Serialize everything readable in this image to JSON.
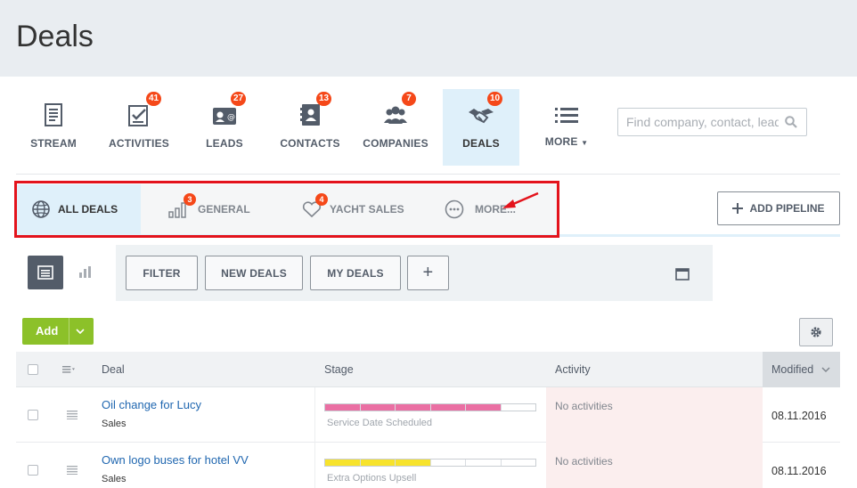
{
  "page": {
    "title": "Deals"
  },
  "nav": {
    "tabs": [
      {
        "label": "STREAM",
        "icon": "stream-icon",
        "count": null
      },
      {
        "label": "ACTIVITIES",
        "icon": "activities-icon",
        "count": "41"
      },
      {
        "label": "LEADS",
        "icon": "leads-icon",
        "count": "27"
      },
      {
        "label": "CONTACTS",
        "icon": "contacts-icon",
        "count": "13"
      },
      {
        "label": "COMPANIES",
        "icon": "companies-icon",
        "count": "7"
      },
      {
        "label": "DEALS",
        "icon": "handshake-icon",
        "count": "10",
        "active": true
      },
      {
        "label": "MORE",
        "icon": "menu-icon",
        "count": null
      }
    ],
    "search_placeholder": "Find company, contact, lead"
  },
  "pipelines": {
    "tabs": [
      {
        "label": "ALL DEALS",
        "icon": "globe-icon",
        "active": true
      },
      {
        "label": "GENERAL",
        "icon": "bar-chart-icon",
        "count": "3"
      },
      {
        "label": "YACHT SALES",
        "icon": "heart-icon",
        "count": "4"
      },
      {
        "label": "MORE...",
        "icon": "more-dots-icon"
      }
    ],
    "add_label": "ADD PIPELINE"
  },
  "filters": {
    "buttons": [
      {
        "label": "FILTER"
      },
      {
        "label": "NEW DEALS"
      },
      {
        "label": "MY DEALS"
      },
      {
        "label": "+"
      }
    ]
  },
  "toolbar": {
    "add_label": "Add"
  },
  "table": {
    "columns": {
      "deal": "Deal",
      "stage": "Stage",
      "activity": "Activity",
      "modified": "Modified"
    },
    "rows": [
      {
        "title": "Oil change for Lucy",
        "pipeline": "Sales",
        "stage": "Service Date Scheduled",
        "stage_progress_segments": 5,
        "stage_color": "#ea6fa3",
        "activity": "No activities",
        "modified": "08.11.2016"
      },
      {
        "title": "Own logo buses for hotel VV",
        "pipeline": "Sales",
        "stage": "Extra Options Upsell",
        "stage_progress_segments": 3,
        "stage_color": "#f7e32c",
        "activity": "No activities",
        "modified": "08.11.2016"
      }
    ]
  },
  "colors": {
    "badge": "#f54819",
    "active_tab_bg": "#dff0fa",
    "add_button": "#8cc129",
    "link": "#2067b0",
    "highlight_frame": "#e3131c"
  }
}
